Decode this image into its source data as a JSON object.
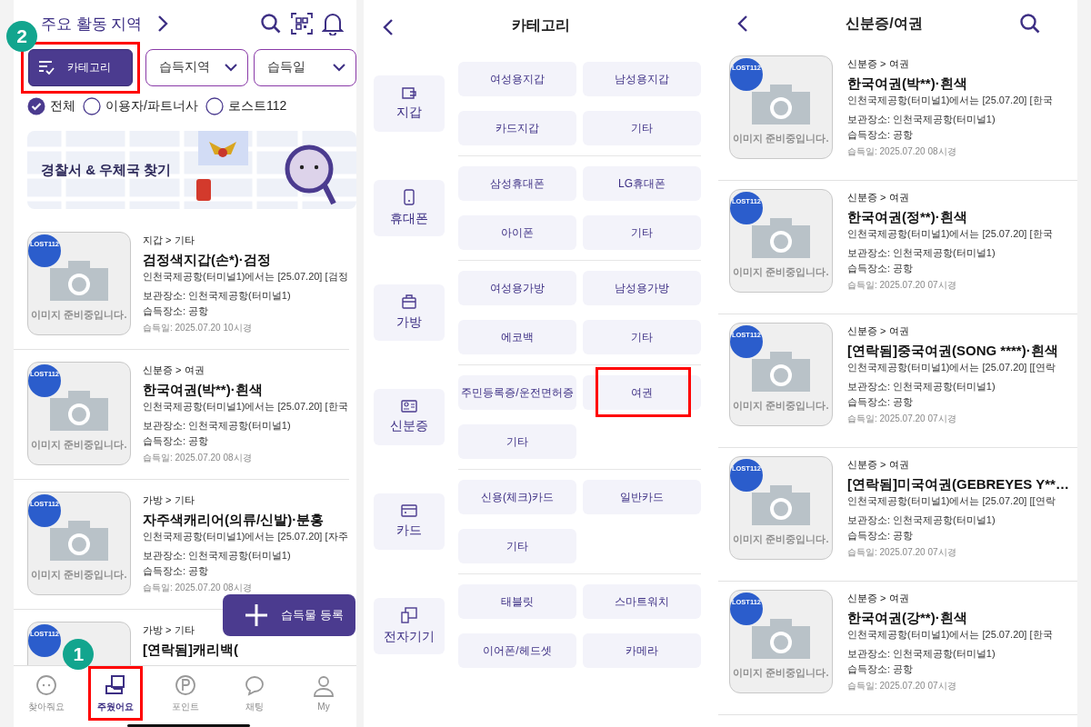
{
  "left": {
    "header": {
      "title": "주요 활동 지역"
    },
    "filters": [
      {
        "kind": "button",
        "label": "카테고리",
        "highlighted": true,
        "step": "2"
      },
      {
        "kind": "dropdown",
        "label": "습득지역",
        "highlighted": false
      },
      {
        "kind": "dropdown",
        "label": "습득일",
        "highlighted": false
      }
    ],
    "sources": [
      {
        "label": "전체",
        "selected": true
      },
      {
        "label": "이용자/파트너사",
        "selected": false
      },
      {
        "label": "로스트112",
        "selected": false
      }
    ],
    "banner": {
      "title": "경찰서 & 우체국 찾기"
    },
    "items": [
      {
        "category": "지갑 > 기타",
        "title": "검정색지갑(손*)·검정",
        "summary": "인천국제공항(터미널1)에서는 [25.07.20]  [검정",
        "storage": "보관장소: 인천국제공항(터미널1)",
        "place": "습득장소: 공항",
        "date": "습득일: 2025.07.20 10시경",
        "badge": "LOST112",
        "image_note": "이미지 준비중입니다."
      },
      {
        "category": "신분증 > 여권",
        "title": "한국여권(박**)·흰색",
        "summary": "인천국제공항(터미널1)에서는 [25.07.20]  [한국",
        "storage": "보관장소: 인천국제공항(터미널1)",
        "place": "습득장소: 공항",
        "date": "습득일: 2025.07.20 08시경",
        "badge": "LOST112",
        "image_note": "이미지 준비중입니다."
      },
      {
        "category": "가방 > 기타",
        "title": "자주색캐리어(의류/신발)·분홍",
        "summary": "인천국제공항(터미널1)에서는 [25.07.20]  [자주",
        "storage": "보관장소: 인천국제공항(터미널1)",
        "place": "습득장소: 공항",
        "date": "습득일: 2025.07.20 08시경",
        "badge": "LOST112",
        "image_note": "이미지 준비중입니다."
      },
      {
        "category": "가방 > 기타",
        "title": "[연락됨]캐리백(",
        "badge": "LOST112"
      }
    ],
    "fab": {
      "label": "습득물 등록"
    },
    "nav": [
      {
        "label": "찾아줘요",
        "selected": false,
        "highlighted": false
      },
      {
        "label": "주웠어요",
        "selected": true,
        "highlighted": true,
        "step": "1"
      },
      {
        "label": "포인트",
        "selected": false,
        "highlighted": false
      },
      {
        "label": "채팅",
        "selected": false,
        "highlighted": false
      },
      {
        "label": "My",
        "selected": false,
        "highlighted": false
      }
    ]
  },
  "middle": {
    "title": "카테고리",
    "groups": [
      {
        "name": "지갑",
        "options": [
          {
            "label": "여성용지갑",
            "highlighted": false
          },
          {
            "label": "남성용지갑",
            "highlighted": false
          },
          {
            "label": "카드지갑",
            "highlighted": false
          },
          {
            "label": "기타",
            "highlighted": false
          }
        ]
      },
      {
        "name": "휴대폰",
        "options": [
          {
            "label": "삼성휴대폰",
            "highlighted": false
          },
          {
            "label": "LG휴대폰",
            "highlighted": false
          },
          {
            "label": "아이폰",
            "highlighted": false
          },
          {
            "label": "기타",
            "highlighted": false
          }
        ]
      },
      {
        "name": "가방",
        "options": [
          {
            "label": "여성용가방",
            "highlighted": false
          },
          {
            "label": "남성용가방",
            "highlighted": false
          },
          {
            "label": "에코백",
            "highlighted": false
          },
          {
            "label": "기타",
            "highlighted": false
          }
        ]
      },
      {
        "name": "신분증",
        "options": [
          {
            "label": "주민등록증/운전면허증",
            "highlighted": false
          },
          {
            "label": "여권",
            "highlighted": true
          },
          {
            "label": "기타",
            "highlighted": false
          }
        ]
      },
      {
        "name": "카드",
        "options": [
          {
            "label": "신용(체크)카드",
            "highlighted": false
          },
          {
            "label": "일반카드",
            "highlighted": false
          },
          {
            "label": "기타",
            "highlighted": false
          }
        ]
      },
      {
        "name": "전자기기",
        "options": [
          {
            "label": "태블릿",
            "highlighted": false
          },
          {
            "label": "스마트워치",
            "highlighted": false
          },
          {
            "label": "이어폰/헤드셋",
            "highlighted": false
          },
          {
            "label": "카메라",
            "highlighted": false
          }
        ]
      }
    ]
  },
  "right": {
    "title": "신분증/여권",
    "items": [
      {
        "category": "신분증 > 여권",
        "title": "한국여권(박**)·흰색",
        "summary": "인천국제공항(터미널1)에서는 [25.07.20]  [한국",
        "storage": "보관장소: 인천국제공항(터미널1)",
        "place": "습득장소: 공항",
        "date": "습득일: 2025.07.20 08시경",
        "badge": "LOST112",
        "image_note": "이미지 준비중입니다."
      },
      {
        "category": "신분증 > 여권",
        "title": "한국여권(정**)·흰색",
        "summary": "인천국제공항(터미널1)에서는 [25.07.20]  [한국",
        "storage": "보관장소: 인천국제공항(터미널1)",
        "place": "습득장소: 공항",
        "date": "습득일: 2025.07.20 07시경",
        "badge": "LOST112",
        "image_note": "이미지 준비중입니다."
      },
      {
        "category": "신분증 > 여권",
        "title": "[연락됨]중국여권(SONG ****)·흰색",
        "summary": "인천국제공항(터미널1)에서는 [25.07.20]  [[연락",
        "storage": "보관장소: 인천국제공항(터미널1)",
        "place": "습득장소: 공항",
        "date": "습득일: 2025.07.20 07시경",
        "badge": "LOST112",
        "image_note": "이미지 준비중입니다."
      },
      {
        "category": "신분증 > 여권",
        "title": "[연락됨]미국여권(GEBREYES Y**…",
        "summary": "인천국제공항(터미널1)에서는 [25.07.20]  [[연락",
        "storage": "보관장소: 인천국제공항(터미널1)",
        "place": "습득장소: 공항",
        "date": "습득일: 2025.07.20 07시경",
        "badge": "LOST112",
        "image_note": "이미지 준비중입니다."
      },
      {
        "category": "신분증 > 여권",
        "title": "한국여권(강**)·흰색",
        "summary": "인천국제공항(터미널1)에서는 [25.07.20]  [한국",
        "storage": "보관장소: 인천국제공항(터미널1)",
        "place": "습득장소: 공항",
        "date": "습득일: 2025.07.20 07시경",
        "badge": "LOST112",
        "image_note": "이미지 준비중입니다."
      }
    ]
  }
}
